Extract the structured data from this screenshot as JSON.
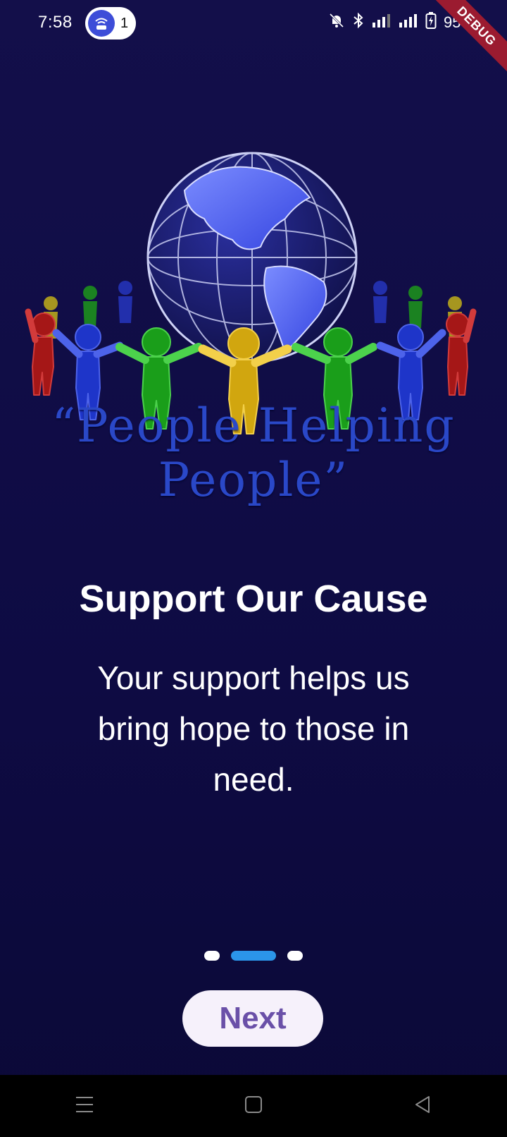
{
  "status_bar": {
    "time": "7:58",
    "notification_count": "1",
    "battery": "95%",
    "debug_banner": "DEBUG"
  },
  "logo": {
    "tagline": "“People Helping People”"
  },
  "onboarding": {
    "title": "Support Our Cause",
    "description": "Your support helps us bring hope to those in need.",
    "page_count": 3,
    "active_page": 2,
    "next_label": "Next"
  },
  "colors": {
    "background": "#130f4a",
    "active_dot": "#2b95e9",
    "button_bg": "#f6f1fb",
    "button_text": "#6a50a8"
  },
  "nav_bar": {
    "icons": [
      "menu-icon",
      "home-icon",
      "back-icon"
    ]
  }
}
